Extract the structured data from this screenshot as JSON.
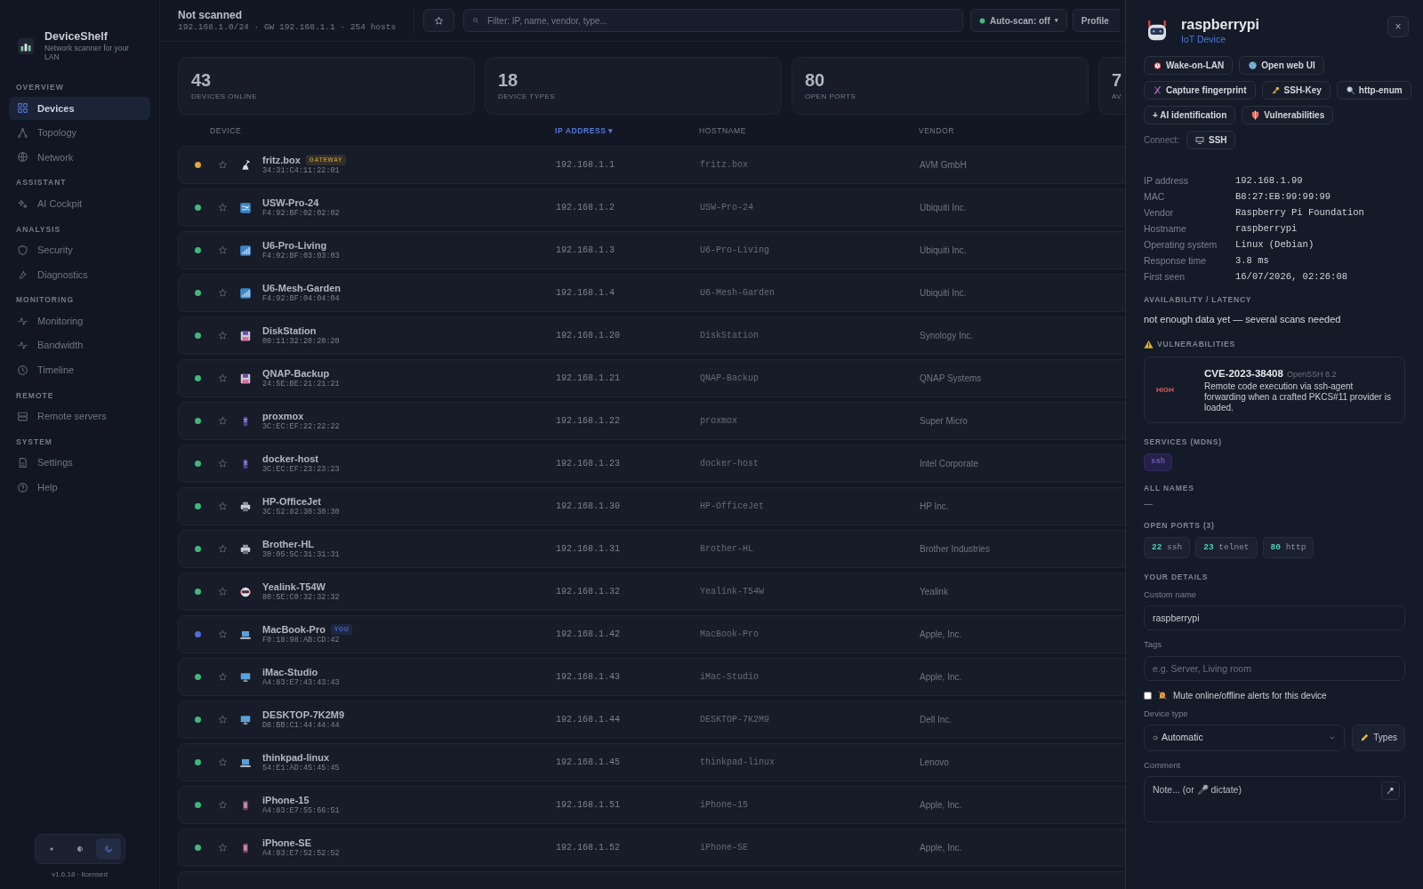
{
  "app": {
    "name": "DeviceShelf",
    "tagline": "Network scanner for your LAN",
    "version": "v1.6.18 · licensed"
  },
  "sidebar": {
    "sections": [
      {
        "title": "OVERVIEW",
        "items": [
          {
            "label": "Devices",
            "selected": true
          },
          {
            "label": "Topology",
            "selected": false
          },
          {
            "label": "Network",
            "selected": false
          }
        ]
      },
      {
        "title": "ASSISTANT",
        "items": [
          {
            "label": "AI Cockpit",
            "selected": false
          }
        ]
      },
      {
        "title": "ANALYSIS",
        "items": [
          {
            "label": "Security",
            "selected": false
          },
          {
            "label": "Diagnostics",
            "selected": false
          }
        ]
      },
      {
        "title": "MONITORING",
        "items": [
          {
            "label": "Monitoring",
            "selected": false
          },
          {
            "label": "Bandwidth",
            "selected": false
          },
          {
            "label": "Timeline",
            "selected": false
          }
        ]
      },
      {
        "title": "REMOTE",
        "items": [
          {
            "label": "Remote servers",
            "selected": false
          }
        ]
      },
      {
        "title": "SYSTEM",
        "items": [
          {
            "label": "Settings",
            "selected": false
          },
          {
            "label": "Help",
            "selected": false
          }
        ]
      }
    ],
    "theme_toggle": [
      {
        "kind": "light",
        "selected": false
      },
      {
        "kind": "auto",
        "selected": false
      },
      {
        "kind": "dark",
        "selected": true
      }
    ]
  },
  "header": {
    "title": "Not scanned",
    "subtitle": "192.168.1.0/24 · GW 192.168.1.1 · 254 hosts",
    "filter": {
      "placeholder": "Filter: IP, name, vendor, type..."
    },
    "auto_scan": {
      "label": "Auto-scan: off",
      "caret": "▾"
    },
    "profile": "Profile"
  },
  "stats": [
    {
      "value": "43",
      "label": "DEVICES ONLINE"
    },
    {
      "value": "18",
      "label": "DEVICE TYPES"
    },
    {
      "value": "80",
      "label": "OPEN PORTS"
    },
    {
      "value": "7",
      "label": "AV"
    }
  ],
  "table": {
    "columns": [
      {
        "label": "DEVICE",
        "sorted": false
      },
      {
        "label": "IP ADDRESS",
        "sorted": true
      },
      {
        "label": "HOSTNAME",
        "sorted": false
      },
      {
        "label": "VENDOR",
        "sorted": false
      }
    ],
    "sort_mark": "▾",
    "rows": [
      {
        "name": "fritz.box",
        "badge": {
          "label": "GATEWAY",
          "color": "#b08c33"
        },
        "mac": "34:31:C4:11:22:01",
        "ip": "192.168.1.1",
        "hostname": "fritz.box",
        "vendor": "AVM GmbH",
        "color": "#e0a93a",
        "starred": false,
        "kind": "router"
      },
      {
        "name": "USW-Pro-24",
        "mac": "F4:92:BF:02:02:02",
        "ip": "192.168.1.2",
        "hostname": "USW-Pro-24",
        "vendor": "Ubiquiti Inc.",
        "color": "#3fb97a",
        "starred": false,
        "kind": "switch"
      },
      {
        "name": "U6-Pro-Living",
        "mac": "F4:92:BF:03:03:03",
        "ip": "192.168.1.3",
        "hostname": "U6-Pro-Living",
        "vendor": "Ubiquiti Inc.",
        "color": "#3fb97a",
        "starred": false,
        "kind": "ap"
      },
      {
        "name": "U6-Mesh-Garden",
        "mac": "F4:92:BF:04:04:04",
        "ip": "192.168.1.4",
        "hostname": "U6-Mesh-Garden",
        "vendor": "Ubiquiti Inc.",
        "color": "#3fb97a",
        "starred": false,
        "kind": "ap"
      },
      {
        "name": "DiskStation",
        "mac": "00:11:32:20:20:20",
        "ip": "192.168.1.20",
        "hostname": "DiskStation",
        "vendor": "Synology Inc.",
        "color": "#3fb97a",
        "starred": false,
        "kind": "nas"
      },
      {
        "name": "QNAP-Backup",
        "mac": "24:5E:BE:21:21:21",
        "ip": "192.168.1.21",
        "hostname": "QNAP-Backup",
        "vendor": "QNAP Systems",
        "color": "#3fb97a",
        "starred": false,
        "kind": "nas"
      },
      {
        "name": "proxmox",
        "mac": "3C:EC:EF:22:22:22",
        "ip": "192.168.1.22",
        "hostname": "proxmox",
        "vendor": "Super Micro",
        "color": "#3fb97a",
        "starred": false,
        "kind": "server"
      },
      {
        "name": "docker-host",
        "mac": "3C:EC:EF:23:23:23",
        "ip": "192.168.1.23",
        "hostname": "docker-host",
        "vendor": "Intel Corporate",
        "color": "#3fb97a",
        "starred": false,
        "kind": "server"
      },
      {
        "name": "HP-OfficeJet",
        "mac": "3C:52:82:30:30:30",
        "ip": "192.168.1.30",
        "hostname": "HP-OfficeJet",
        "vendor": "HP Inc.",
        "color": "#3fb97a",
        "starred": false,
        "kind": "printer"
      },
      {
        "name": "Brother-HL",
        "mac": "30:05:5C:31:31:31",
        "ip": "192.168.1.31",
        "hostname": "Brother-HL",
        "vendor": "Brother Industries",
        "color": "#3fb97a",
        "starred": false,
        "kind": "printer"
      },
      {
        "name": "Yealink-T54W",
        "mac": "80:5E:C0:32:32:32",
        "ip": "192.168.1.32",
        "hostname": "Yealink-T54W",
        "vendor": "Yealink",
        "color": "#3fb97a",
        "starred": false,
        "kind": "voip"
      },
      {
        "name": "MacBook-Pro",
        "badge": {
          "label": "YOU",
          "color": "#4966c2"
        },
        "mac": "F0:18:98:AB:CD:42",
        "ip": "192.168.1.42",
        "hostname": "MacBook-Pro",
        "vendor": "Apple, Inc.",
        "color": "#4f6fd6",
        "starred": false,
        "kind": "laptop"
      },
      {
        "name": "iMac-Studio",
        "mac": "A4:83:E7:43:43:43",
        "ip": "192.168.1.43",
        "hostname": "iMac-Studio",
        "vendor": "Apple, Inc.",
        "color": "#3fb97a",
        "starred": false,
        "kind": "desktop"
      },
      {
        "name": "DESKTOP-7K2M9",
        "mac": "D8:BB:C1:44:44:44",
        "ip": "192.168.1.44",
        "hostname": "DESKTOP-7K2M9",
        "vendor": "Dell Inc.",
        "color": "#3fb97a",
        "starred": false,
        "kind": "desktop"
      },
      {
        "name": "thinkpad-linux",
        "mac": "54:E1:AD:45:45:45",
        "ip": "192.168.1.45",
        "hostname": "thinkpad-linux",
        "vendor": "Lenovo",
        "color": "#3fb97a",
        "starred": false,
        "kind": "laptop"
      },
      {
        "name": "iPhone-15",
        "mac": "A4:83:E7:55:66:51",
        "ip": "192.168.1.51",
        "hostname": "iPhone-15",
        "vendor": "Apple, Inc.",
        "color": "#3fb97a",
        "starred": false,
        "kind": "phone"
      },
      {
        "name": "iPhone-SE",
        "mac": "A4:83:E7:52:52:52",
        "ip": "192.168.1.52",
        "hostname": "iPhone-SE",
        "vendor": "Apple, Inc.",
        "color": "#3fb97a",
        "starred": false,
        "kind": "phone"
      }
    ]
  },
  "drawer": {
    "title": "raspberrypi",
    "type": "IoT Device",
    "close": "×",
    "actions": [
      {
        "label": "Wake-on-LAN",
        "kind": "clock"
      },
      {
        "label": "Open web UI",
        "kind": "globe"
      },
      {
        "label": "Capture fingerprint",
        "kind": "dna"
      },
      {
        "label": "SSH-Key",
        "kind": "key"
      },
      {
        "label": "http-enum",
        "kind": "search"
      },
      {
        "label": "+ AI identification",
        "kind": "none"
      },
      {
        "label": "Vulnerabilities",
        "kind": "shield"
      }
    ],
    "connect": {
      "label": "Connect:",
      "buttons": [
        {
          "label": "SSH"
        }
      ]
    },
    "details": [
      {
        "label": "IP address",
        "value": "192.168.1.99"
      },
      {
        "label": "MAC",
        "value": "B8:27:EB:99:99:99"
      },
      {
        "label": "Vendor",
        "value": "Raspberry Pi Foundation"
      },
      {
        "label": "Hostname",
        "value": "raspberrypi"
      },
      {
        "label": "Operating system",
        "value": "Linux (Debian)"
      },
      {
        "label": "Response time",
        "value": "3.8 ms"
      },
      {
        "label": "First seen",
        "value": "16/07/2026, 02:26:08"
      }
    ],
    "availability": {
      "title": "AVAILABILITY / LATENCY",
      "text": "not enough data yet — several scans needed"
    },
    "vulnerabilities": {
      "title": "VULNERABILITIES",
      "items": [
        {
          "severity": "HIGH",
          "id": "CVE-2023-38408",
          "product": "OpenSSH 8.2",
          "description": "Remote code execution via ssh-agent forwarding when a crafted PKCS#11 provider is loaded."
        }
      ]
    },
    "services": {
      "title": "SERVICES (MDNS)",
      "items": [
        "ssh"
      ]
    },
    "all_names": {
      "title": "ALL NAMES",
      "text": "—"
    },
    "open_ports": {
      "title": "OPEN PORTS (3)",
      "items": [
        {
          "port": "22",
          "service": "ssh"
        },
        {
          "port": "23",
          "service": "telnet"
        },
        {
          "port": "80",
          "service": "http"
        }
      ]
    },
    "your_details": {
      "title": "YOUR DETAILS",
      "custom_name": {
        "label": "Custom name",
        "value": "raspberrypi"
      },
      "tags": {
        "label": "Tags",
        "placeholder": "e.g. Server, Living room"
      },
      "mute": {
        "label": "Mute online/offline alerts for this device",
        "checked": false
      },
      "device_type": {
        "label": "Device type",
        "value": "Automatic",
        "types_button": "Types"
      },
      "comment": {
        "label": "Comment",
        "placeholder": "Note... (or 🎤 dictate)"
      }
    }
  }
}
